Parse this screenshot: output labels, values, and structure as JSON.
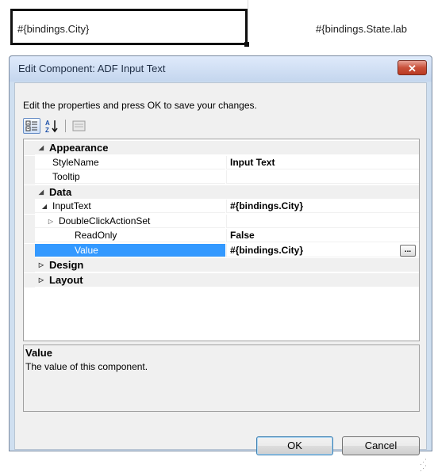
{
  "canvas": {
    "city_field": "#{bindings.City}",
    "state_label": "#{bindings.State.lab"
  },
  "dialog": {
    "title": "Edit Component: ADF Input Text",
    "close_label": "✕",
    "instructions": "Edit the properties and press OK to save your changes.",
    "toolbar": {
      "categorized_icon": "categorized-icon",
      "alphabetical_icon": "alphabetical-sort-icon",
      "pages_icon": "property-pages-icon"
    },
    "grid": {
      "rows": [
        {
          "type": "category",
          "name": "Appearance",
          "expanded": true
        },
        {
          "type": "prop",
          "indent": 1,
          "name": "StyleName",
          "value": "Input  Text"
        },
        {
          "type": "prop",
          "indent": 1,
          "name": "Tooltip",
          "value": ""
        },
        {
          "type": "category",
          "name": "Data",
          "expanded": true
        },
        {
          "type": "prop",
          "indent": 1,
          "name": "InputText",
          "value": "#{bindings.City}",
          "expandable": "open"
        },
        {
          "type": "prop",
          "indent": 2,
          "name": "DoubleClickActionSet",
          "value": "",
          "expandable": "closed"
        },
        {
          "type": "prop",
          "indent": 3,
          "name": "ReadOnly",
          "value": "False"
        },
        {
          "type": "prop",
          "indent": 3,
          "name": "Value",
          "value": "#{bindings.City}",
          "selected": true
        },
        {
          "type": "category",
          "name": "Design",
          "expanded": false
        },
        {
          "type": "category",
          "name": "Layout",
          "expanded": false
        }
      ],
      "ellipsis_label": "..."
    },
    "description": {
      "title": "Value",
      "text": "The value of this component."
    },
    "buttons": {
      "ok": "OK",
      "cancel": "Cancel"
    },
    "colors": {
      "selection": "#3399ff",
      "close_button": "#c9503a",
      "title_bar": "#cfdff0"
    }
  }
}
